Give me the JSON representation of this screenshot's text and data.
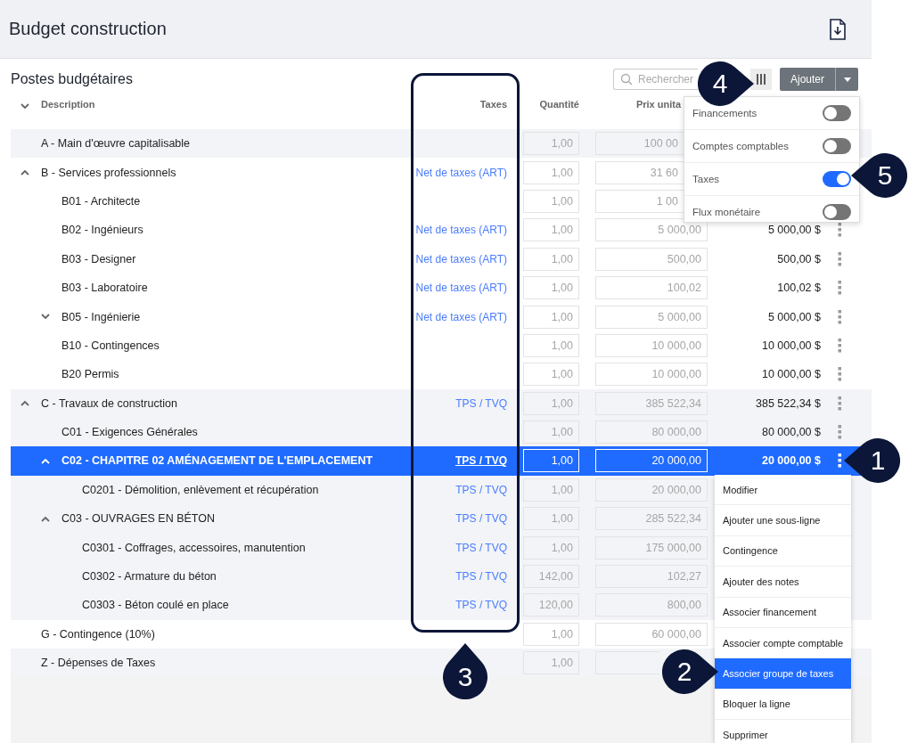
{
  "page_title": "Budget construction",
  "section_title": "Postes budgétaires",
  "search": {
    "placeholder": "Rechercher"
  },
  "add_button": "Ajouter",
  "columns": [
    "Description",
    "Taxes",
    "Quantité",
    "Prix unita"
  ],
  "rows": [
    {
      "description": "A - Main d'œuvre capitalisable",
      "quantity": "1,00",
      "unit_price": "100 00",
      "covered": true,
      "shaded": true,
      "selected": false
    },
    {
      "description": "B - Services professionnels",
      "taxes": "Net de taxes (ART)",
      "quantity": "1,00",
      "unit_price": "31 60",
      "covered": true,
      "shaded": false,
      "selected": false,
      "expanded": true,
      "children": [
        {
          "description": "B01 - Architecte",
          "quantity": "1,00",
          "unit_price": "1 00",
          "covered": true,
          "shaded": false,
          "selected": false
        },
        {
          "description": "B02 - Ingénieurs",
          "taxes": "Net de taxes (ART)",
          "quantity": "1,00",
          "unit_price": "5 000,00",
          "total": "5 000,00 $",
          "shaded": false,
          "selected": false
        },
        {
          "description": "B03 - Designer",
          "taxes": "Net de taxes (ART)",
          "quantity": "1,00",
          "unit_price": "500,00",
          "total": "500,00 $",
          "shaded": false,
          "selected": false
        },
        {
          "description": "B03 - Laboratoire",
          "taxes": "Net de taxes (ART)",
          "quantity": "1,00",
          "unit_price": "100,02",
          "total": "100,02 $",
          "shaded": false,
          "selected": false
        },
        {
          "description": "B05 - Ingénierie",
          "taxes": "Net de taxes (ART)",
          "quantity": "1,00",
          "unit_price": "5 000,00",
          "total": "5 000,00 $",
          "shaded": false,
          "selected": false,
          "expanded": false
        },
        {
          "description": "B10 - Contingences",
          "quantity": "1,00",
          "unit_price": "10 000,00",
          "total": "10 000,00 $",
          "shaded": false,
          "selected": false
        },
        {
          "description": "B20 Permis",
          "quantity": "1,00",
          "unit_price": "10 000,00",
          "total": "10 000,00 $",
          "shaded": false,
          "selected": false
        }
      ]
    },
    {
      "description": "C - Travaux de construction",
      "taxes": "TPS / TVQ",
      "quantity": "1,00",
      "unit_price": "385 522,34",
      "total": "385 522,34 $",
      "shaded": true,
      "selected": false,
      "expanded": true,
      "children": [
        {
          "description": "C01 - Exigences Générales",
          "quantity": "1,00",
          "unit_price": "80 000,00",
          "total": "80 000,00 $",
          "shaded": true,
          "selected": false
        },
        {
          "description": "C02 - CHAPITRE 02 AMÉNAGEMENT DE L'EMPLACEMENT",
          "taxes": "TPS / TVQ",
          "quantity": "1,00",
          "unit_price": "20 000,00",
          "total": "20 000,00 $",
          "shaded": true,
          "selected": true,
          "expanded": true,
          "children": [
            {
              "description": "C0201 - Démolition, enlèvement et récupération",
              "taxes": "TPS / TVQ",
              "quantity": "1,00",
              "unit_price": "20 000,00",
              "shaded": true,
              "selected": false
            }
          ]
        },
        {
          "description": "C03 - OUVRAGES EN BÉTON",
          "taxes": "TPS / TVQ",
          "quantity": "1,00",
          "unit_price": "285 522,34",
          "shaded": true,
          "selected": false,
          "expanded": true,
          "children": [
            {
              "description": "C0301 - Coffrages, accessoires, manutention",
              "taxes": "TPS / TVQ",
              "quantity": "1,00",
              "unit_price": "175 000,00",
              "shaded": true,
              "selected": false
            },
            {
              "description": "C0302 - Armature du béton",
              "taxes": "TPS / TVQ",
              "quantity": "142,00",
              "unit_price": "102,27",
              "shaded": true,
              "selected": false
            },
            {
              "description": "C0303 - Béton coulé en place",
              "taxes": "TPS / TVQ",
              "quantity": "120,00",
              "unit_price": "800,00",
              "shaded": true,
              "selected": false
            }
          ]
        }
      ]
    },
    {
      "description": "G - Contingence (10%)",
      "quantity": "1,00",
      "unit_price": "60 000,00",
      "shaded": false,
      "selected": false
    },
    {
      "description": "Z - Dépenses de Taxes",
      "quantity": "1,00",
      "shaded": true,
      "selected": false
    }
  ],
  "columns_panel": {
    "items": [
      {
        "label": "Financements",
        "on": false
      },
      {
        "label": "Comptes comptables",
        "on": false
      },
      {
        "label": "Taxes",
        "on": true
      },
      {
        "label": "Flux monétaire",
        "on": false
      }
    ]
  },
  "row_menu": {
    "items": [
      {
        "label": "Modifier",
        "selected": false
      },
      {
        "label": "Ajouter une sous-ligne",
        "selected": false
      },
      {
        "label": "Contingence",
        "selected": false
      },
      {
        "label": "Ajouter des notes",
        "selected": false
      },
      {
        "label": "Associer financement",
        "selected": false
      },
      {
        "label": "Associer compte comptable",
        "selected": false
      },
      {
        "label": "Associer groupe de taxes",
        "selected": true
      },
      {
        "label": "Bloquer la ligne",
        "selected": false
      },
      {
        "label": "Supprimer",
        "selected": false
      }
    ]
  },
  "callouts": [
    {
      "number": "1"
    },
    {
      "number": "2"
    },
    {
      "number": "3"
    },
    {
      "number": "4"
    },
    {
      "number": "5"
    }
  ]
}
